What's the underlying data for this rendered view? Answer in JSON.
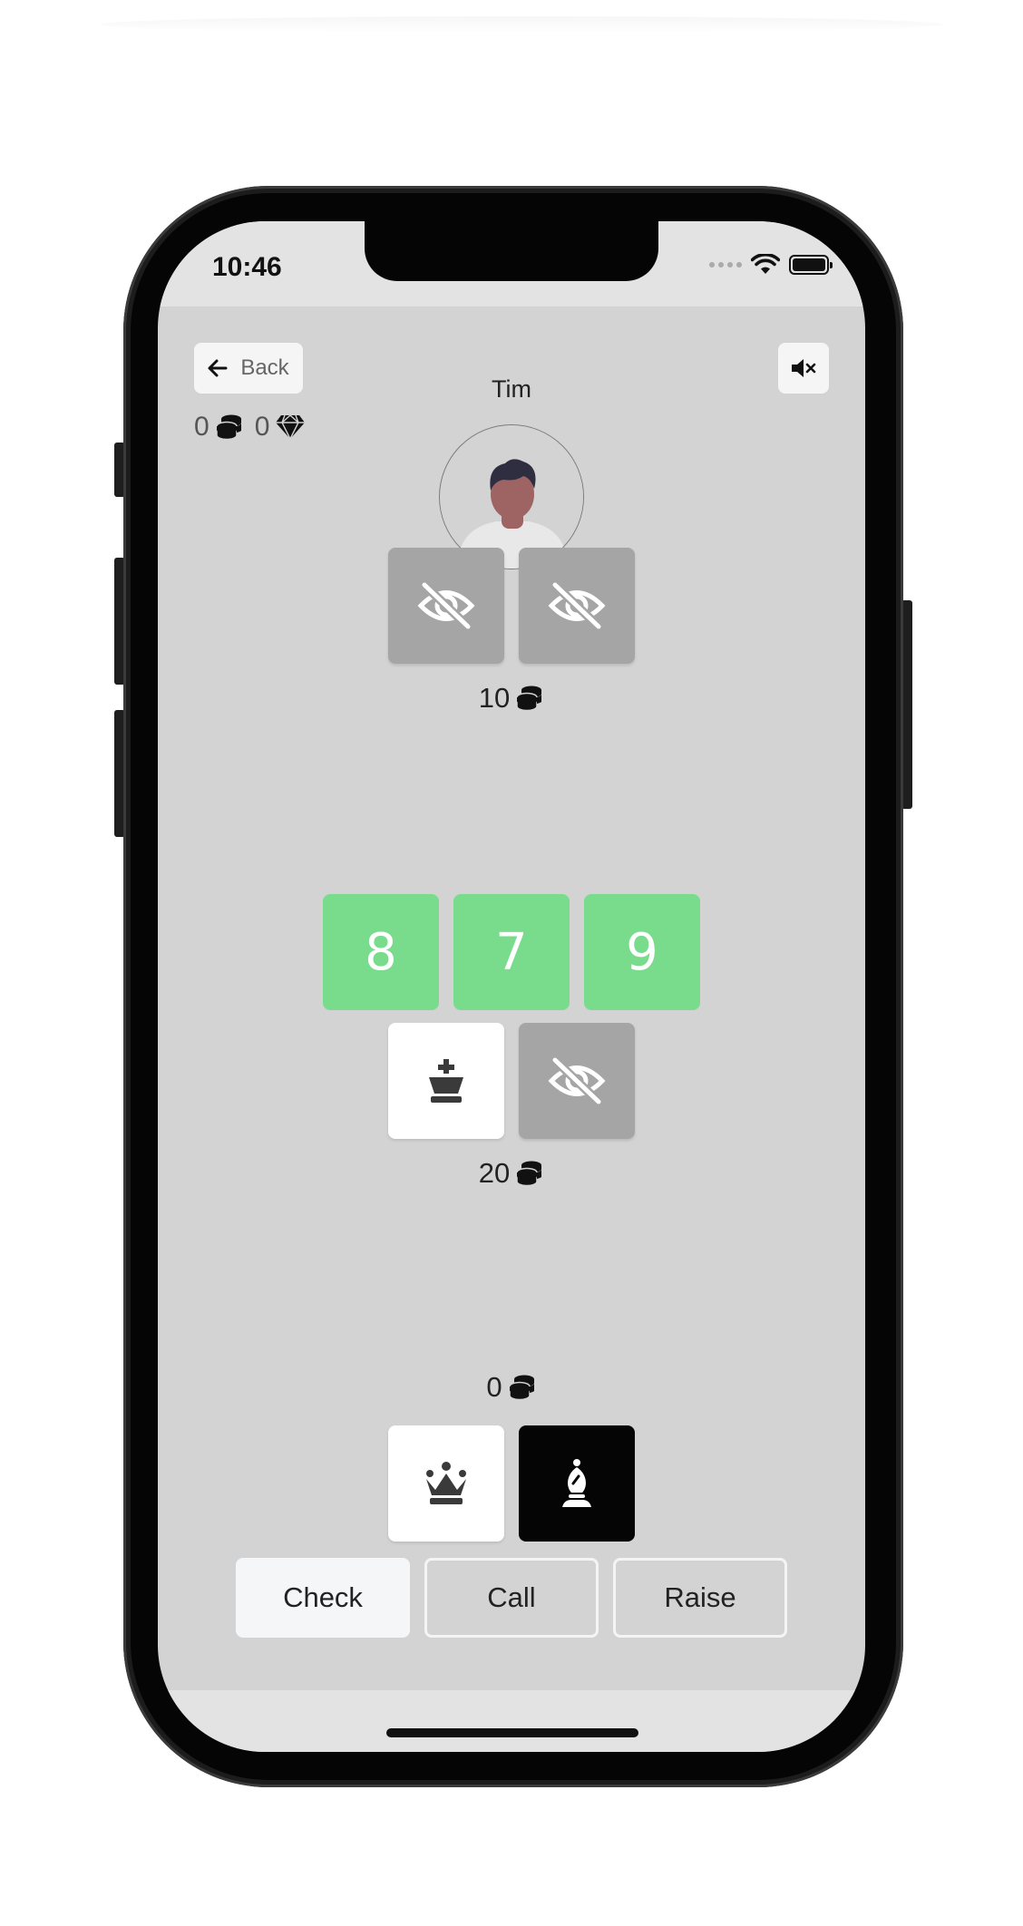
{
  "status_bar": {
    "time": "10:46"
  },
  "header": {
    "back_label": "Back",
    "coins": "0",
    "gems": "0"
  },
  "opponent": {
    "name": "Tim",
    "bet": "10",
    "cards": [
      "hidden",
      "hidden"
    ]
  },
  "board": {
    "cards": [
      "8",
      "7",
      "9"
    ],
    "pot": "20"
  },
  "mid_cards": [
    "king-piece",
    "hidden"
  ],
  "player": {
    "bet": "0",
    "cards": [
      "queen-piece",
      "bishop-piece"
    ]
  },
  "actions": {
    "check": "Check",
    "call": "Call",
    "raise": "Raise"
  },
  "colors": {
    "screen_bg": "#d3d3d3",
    "hidden_card": "#a5a5a5",
    "board_card": "#79dc8d",
    "button_bg": "#f5f6f8"
  }
}
